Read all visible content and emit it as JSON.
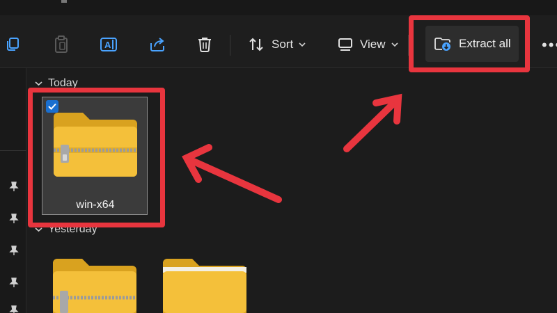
{
  "toolbar": {
    "sort_label": "Sort",
    "view_label": "View",
    "extract_label": "Extract all",
    "more_label": "•••"
  },
  "groups": [
    {
      "label": "Today"
    },
    {
      "label": "Yesterday"
    }
  ],
  "files": [
    {
      "name": "win-x64",
      "type": "zip",
      "selected": true
    }
  ],
  "colors": {
    "highlight": "#e8353e",
    "folder": "#f4c03a",
    "selection_check": "#1a6fcf",
    "background": "#1c1c1c"
  }
}
